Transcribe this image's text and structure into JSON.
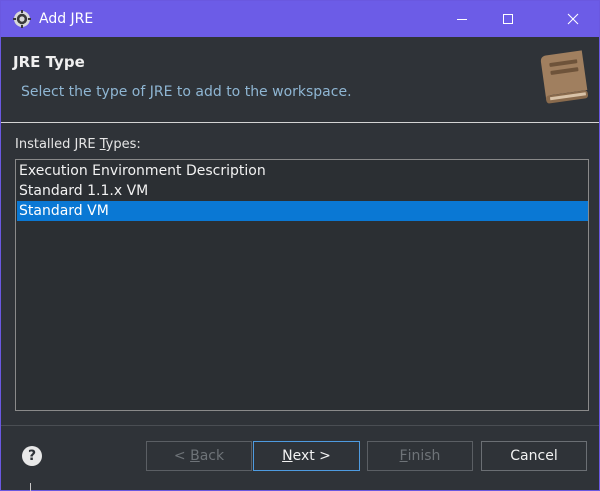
{
  "window": {
    "title": "Add JRE"
  },
  "banner": {
    "title": "JRE Type",
    "description": "Select the type of JRE to add to the workspace.",
    "icon": "jre-book-icon"
  },
  "list": {
    "label_prefix": "Installed JRE ",
    "label_mnemonic": "T",
    "label_suffix": "ypes:",
    "items": [
      {
        "label": "Execution Environment Description",
        "selected": false
      },
      {
        "label": "Standard 1.1.x VM",
        "selected": false
      },
      {
        "label": "Standard VM",
        "selected": true
      }
    ]
  },
  "buttons": {
    "back": {
      "prefix": "< ",
      "mnemonic": "B",
      "rest": "ack",
      "enabled": false
    },
    "next": {
      "mnemonic": "N",
      "rest": "ext >",
      "enabled": true
    },
    "finish": {
      "mnemonic": "F",
      "rest": "inish",
      "enabled": false
    },
    "cancel": {
      "label": "Cancel",
      "enabled": true
    }
  },
  "help": {
    "glyph": "?"
  },
  "colors": {
    "titlebar": "#6c5ce7",
    "background": "#2f3338",
    "selection": "#0a78d4",
    "description_text": "#8fb6d3",
    "default_button_border": "#4e9be0"
  }
}
